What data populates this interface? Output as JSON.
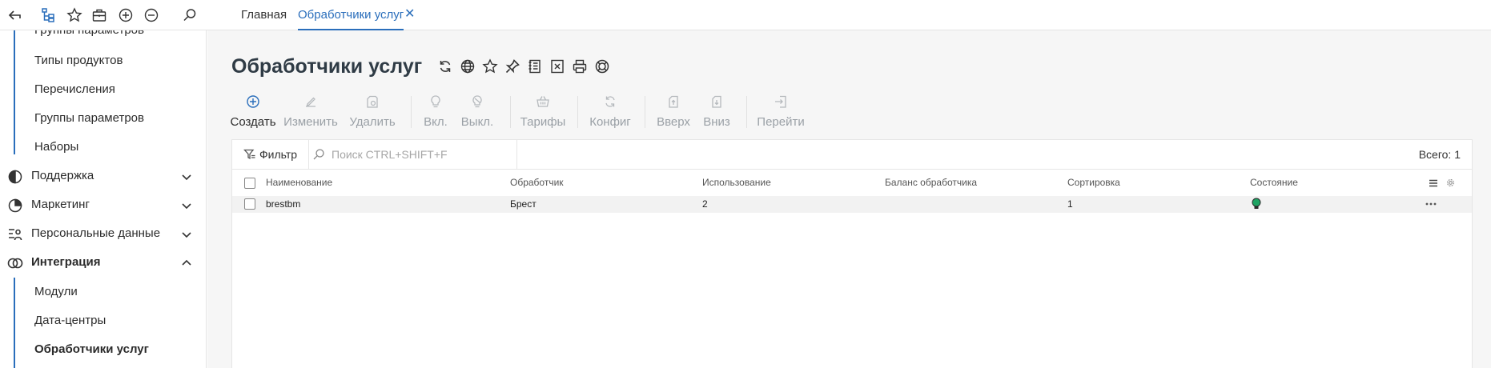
{
  "topbar": {
    "tabs": [
      {
        "label": "Главная",
        "active": false
      },
      {
        "label": "Обработчики услуг",
        "active": true
      }
    ]
  },
  "sidebar": {
    "partial_top_label": "Группы параметров",
    "sub_items_top": [
      "Типы продуктов",
      "Перечисления",
      "Группы параметров",
      "Наборы"
    ],
    "sections": [
      {
        "label": "Поддержка",
        "icon": "support-icon",
        "expanded": false
      },
      {
        "label": "Маркетинг",
        "icon": "marketing-icon",
        "expanded": false
      },
      {
        "label": "Персональные данные",
        "icon": "personal-data-icon",
        "expanded": false
      },
      {
        "label": "Интеграция",
        "icon": "integration-icon",
        "expanded": true
      }
    ],
    "sub_items_bottom": [
      "Модули",
      "Дата-центры",
      "Обработчики услуг"
    ]
  },
  "main": {
    "title": "Обработчики услуг",
    "title_icons": [
      "refresh-icon",
      "globe-icon",
      "star-icon",
      "pin-icon",
      "document-icon",
      "excel-icon",
      "print-icon",
      "help-icon"
    ],
    "toolbar": [
      {
        "label": "Создать",
        "icon": "plus-circle-icon",
        "enabled": true
      },
      {
        "label": "Изменить",
        "icon": "edit-icon",
        "enabled": false
      },
      {
        "label": "Удалить",
        "icon": "delete-icon",
        "enabled": false
      },
      {
        "label": "Вкл.",
        "icon": "bulb-on-icon",
        "enabled": false
      },
      {
        "label": "Выкл.",
        "icon": "bulb-off-icon",
        "enabled": false
      },
      {
        "label": "Тарифы",
        "icon": "basket-icon",
        "enabled": false
      },
      {
        "label": "Конфиг",
        "icon": "config-icon",
        "enabled": false
      },
      {
        "label": "Вверх",
        "icon": "up-icon",
        "enabled": false
      },
      {
        "label": "Вниз",
        "icon": "down-icon",
        "enabled": false
      },
      {
        "label": "Перейти",
        "icon": "goto-icon",
        "enabled": false
      }
    ],
    "filter_label": "Фильтр",
    "search_placeholder": "Поиск CTRL+SHIFT+F",
    "total": "Всего: 1",
    "columns": [
      "Наименование",
      "Обработчик",
      "Использование",
      "Баланс обработчика",
      "Сортировка",
      "Состояние"
    ],
    "rows": [
      {
        "name": "brestbm",
        "handler": "Брест",
        "usage": "2",
        "balance": "",
        "sort": "1",
        "state": "active"
      }
    ]
  },
  "colors": {
    "accent": "#2a6ebb",
    "state_active": "#1fa363",
    "disabled_text": "#9aa0a6"
  }
}
